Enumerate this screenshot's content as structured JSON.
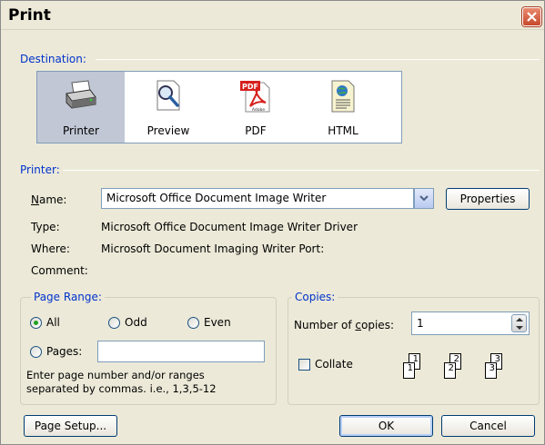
{
  "window": {
    "title": "Print"
  },
  "destination": {
    "group_label": "Destination:",
    "items": [
      {
        "label": "Printer",
        "selected": true
      },
      {
        "label": "Preview",
        "selected": false
      },
      {
        "label": "PDF",
        "selected": false
      },
      {
        "label": "HTML",
        "selected": false
      }
    ],
    "pdf_badge": "PDF",
    "adobe_badge": "Adobe"
  },
  "printer": {
    "group_label": "Printer:",
    "name_label": "Name:",
    "name_value": "Microsoft Office Document Image Writer",
    "properties_label": "Properties",
    "type_label": "Type:",
    "type_value": "Microsoft Office Document Image Writer Driver",
    "where_label": "Where:",
    "where_value": "Microsoft Document Imaging Writer Port:",
    "comment_label": "Comment:",
    "comment_value": ""
  },
  "page_range": {
    "group_label": "Page Range:",
    "all_label": "All",
    "odd_label": "Odd",
    "even_label": "Even",
    "pages_label": "Pages:",
    "pages_value": "",
    "hint_line1": "Enter page number and/or ranges",
    "hint_line2": "separated by commas.  i.e., 1,3,5-12"
  },
  "copies": {
    "group_label": "Copies:",
    "number_label": "Number of copies:",
    "number_value": "1",
    "collate_label": "Collate",
    "collate_checked": false,
    "page_icons": [
      "1",
      "1",
      "2",
      "2",
      "3",
      "3"
    ]
  },
  "footer": {
    "page_setup_label": "Page Setup...",
    "ok_label": "OK",
    "cancel_label": "Cancel"
  }
}
